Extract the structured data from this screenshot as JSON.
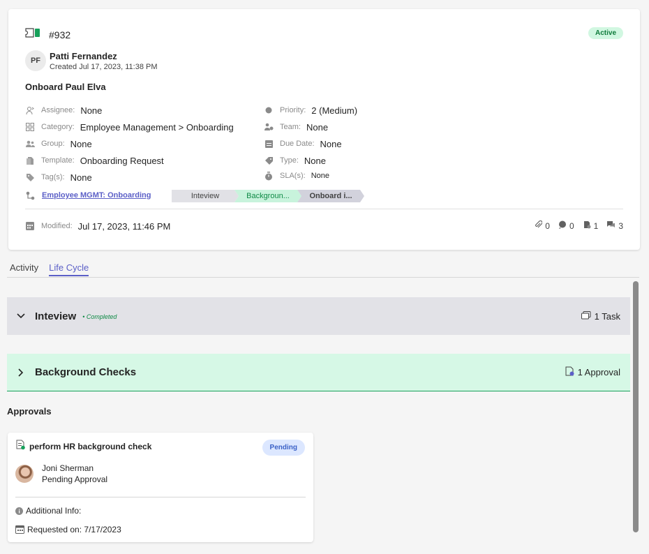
{
  "ticket": {
    "id": "#932",
    "status": "Active",
    "creator_initials": "PF",
    "creator_name": "Patti Fernandez",
    "created": "Created Jul 17, 2023, 11:38 PM",
    "title": "Onboard Paul Elva"
  },
  "fields": {
    "assignee": {
      "label": "Assignee:",
      "value": "None"
    },
    "category": {
      "label": "Category:",
      "value": "Employee Management > Onboarding"
    },
    "group": {
      "label": "Group:",
      "value": "None"
    },
    "template": {
      "label": "Template:",
      "value": "Onboarding Request"
    },
    "tags": {
      "label": "Tag(s):",
      "value": "None"
    },
    "priority": {
      "label": "Priority:",
      "value": "2 (Medium)"
    },
    "team": {
      "label": "Team:",
      "value": "None"
    },
    "due_date": {
      "label": "Due Date:",
      "value": "None"
    },
    "type": {
      "label": "Type:",
      "value": "None"
    },
    "sla": {
      "label": "SLA(s):",
      "value": "None"
    }
  },
  "workflow": {
    "link": "Employee MGMT: Onboarding",
    "stages": [
      "Inteview",
      "Backgroun...",
      "Onboard i..."
    ]
  },
  "modified": {
    "label": "Modified:",
    "value": "Jul 17, 2023, 11:46 PM"
  },
  "counts": {
    "attachments": "0",
    "comments": "0",
    "approvals": "1",
    "chats": "3"
  },
  "tabs": [
    "Activity",
    "Life Cycle"
  ],
  "lifecycle": {
    "panel1": {
      "name": "Inteview",
      "status": "• Completed",
      "summary": "1 Task"
    },
    "panel2": {
      "name": "Background Checks",
      "summary": "1 Approval"
    }
  },
  "approvals": {
    "heading": "Approvals",
    "card": {
      "title": "perform HR background check",
      "status": "Pending",
      "approver_name": "Joni Sherman",
      "approver_status": "Pending Approval",
      "additional_info": "Additional Info:",
      "requested_on": "Requested on: 7/17/2023"
    }
  },
  "colors": {
    "accent": "#5b5fc7",
    "success": "#0e8a45",
    "pending": "#3c62c7"
  }
}
